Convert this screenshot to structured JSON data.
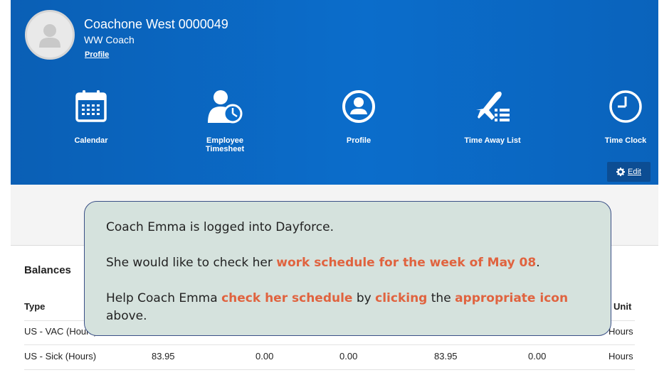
{
  "user": {
    "name": "Coachone West 0000049",
    "role": "WW Coach",
    "profile_link": "Profile"
  },
  "tiles": [
    {
      "label": "Calendar",
      "icon": "calendar-icon"
    },
    {
      "label": "Employee Timesheet",
      "icon": "employee-timesheet-icon"
    },
    {
      "label": "Profile",
      "icon": "profile-icon"
    },
    {
      "label": "Time Away List",
      "icon": "time-away-list-icon"
    },
    {
      "label": "Time Clock",
      "icon": "time-clock-icon"
    }
  ],
  "edit_label": "Edit",
  "balances": {
    "title": "Balances",
    "columns": [
      "Type",
      "Unit"
    ],
    "rows": [
      {
        "type": "US - VAC (Hours)",
        "unit": "Hours"
      },
      {
        "type": "US - Sick (Hours)",
        "v1": "83.95",
        "v2": "0.00",
        "v3": "0.00",
        "v4": "83.95",
        "v5": "0.00",
        "unit": "Hours"
      }
    ]
  },
  "instructions": {
    "line1": "Coach Emma is logged into Dayforce.",
    "line2_a": "She would like to check her ",
    "line2_hl": "work schedule for the week of May 08",
    "line2_b": ".",
    "line3_a": "Help Coach Emma ",
    "line3_hl1": "check her schedule",
    "line3_b": " by ",
    "line3_hl2": "clicking",
    "line3_c": " the ",
    "line3_hl3": "appropriate icon",
    "line3_d": "above."
  },
  "colors": {
    "header_blue": "#0b6dcb",
    "highlight": "#e0633f",
    "overlay_bg": "#d5e2dd"
  }
}
